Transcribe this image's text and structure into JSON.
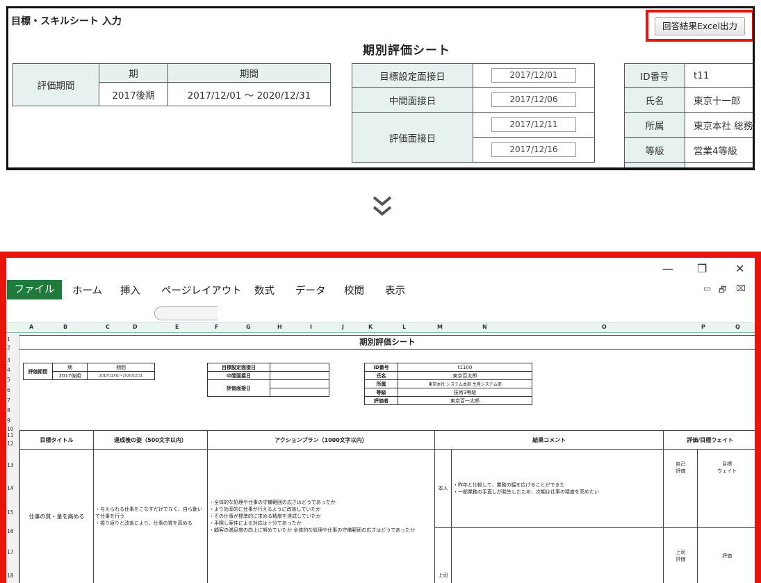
{
  "top": {
    "page_title": "目標・スキルシート 入力",
    "export_button": "回答結果Excel出力",
    "sheet_title": "期別評価シート",
    "period": {
      "label": "評価期間",
      "col_term": "期",
      "col_range": "期間",
      "term": "2017後期",
      "range": "2017/12/01 ～ 2020/12/31"
    },
    "interviews": {
      "goal_label": "目標設定面接日",
      "goal_date": "2017/12/01",
      "mid_label": "中間面接日",
      "mid_date": "2017/12/06",
      "eval_label": "評価面接日",
      "eval_date1": "2017/12/11",
      "eval_date2": "2017/12/16"
    },
    "person": {
      "id_label": "ID番号",
      "id": "t11",
      "name_label": "氏名",
      "name": "東京十一郎",
      "dept_label": "所属",
      "dept": "東京本社 総務",
      "grade_label": "等級",
      "grade": "営業4等級"
    }
  },
  "excel": {
    "win": {
      "minimize": "—",
      "restore": "❐",
      "close": "✕"
    },
    "tabs": {
      "file": "ファイル",
      "home": "ホーム",
      "insert": "挿入",
      "layout": "ページレイアウト",
      "formulas": "数式",
      "data": "データ",
      "review": "校閲",
      "view": "表示"
    },
    "ribbon_icons": {
      "a": "▭",
      "b": "🗗",
      "c": "⌧"
    },
    "columns": [
      "A",
      "B",
      "C",
      "D",
      "E",
      "F",
      "G",
      "H",
      "I",
      "J",
      "K",
      "L",
      "M",
      "N",
      "O",
      "P",
      "Q"
    ],
    "rows": [
      "1",
      "2",
      "3",
      "4",
      "5",
      "6",
      "7",
      "8",
      "9",
      "10",
      "11",
      "12",
      "13",
      "14",
      "15",
      "16",
      "17",
      "18"
    ],
    "sheet_title": "期別評価シート",
    "period": {
      "label": "評価期間",
      "col_term": "期",
      "col_range": "期間",
      "term": "2017後期",
      "range": "2017/12/01～2020/12/31"
    },
    "interviews": {
      "goal_label": "目標設定面接日",
      "mid_label": "中間面接日",
      "eval_label": "評価面接日"
    },
    "person": {
      "id_label": "ID番号",
      "id": "t1100",
      "name_label": "氏名",
      "name": "東京百太郎",
      "dept_label": "所属",
      "dept": "東京本社 システム本部 生産システム部",
      "grade_label": "等級",
      "grade": "技術3等級",
      "evaluator_label": "評価者",
      "evaluator": "東京百一太郎"
    },
    "grid": {
      "h_goal": "目標タイトル",
      "h_result": "達成後の姿（500文字以内）",
      "h_action": "アクションプラン（1000文字以内）",
      "h_comment": "結果コメント",
      "h_eval": "評価/目標ウェイト",
      "goal": "仕事の質・量を高める",
      "result": "・与えられる仕事をこなすだけでなく、自ら動いて仕事を行う\n・振り返りと改善により、仕事の質を高める",
      "action": "・全体的な処理や仕事の守備範囲の広さはどうであったか\n・より効率的に仕事が行えるように改善していたか\n・その仕事が標準的に求める精度を達成していたか\n・手際し案件による対応は十分であったか\n・顧客の満足度の向上に努めていたか 全体的な処理や仕事の守備範囲の広さはどうであったか",
      "self_label": "本人",
      "self_comment": "・昨年と比較して、業務の幅を広げることができた\n・一部業務の手直しが発生したため、次期は仕事の精度を高めたい",
      "boss_label": "上司",
      "self_eval": "自己\n評価",
      "weight": "目標\nウェイト",
      "boss_eval": "上司\n評価",
      "rating": "評価"
    }
  }
}
